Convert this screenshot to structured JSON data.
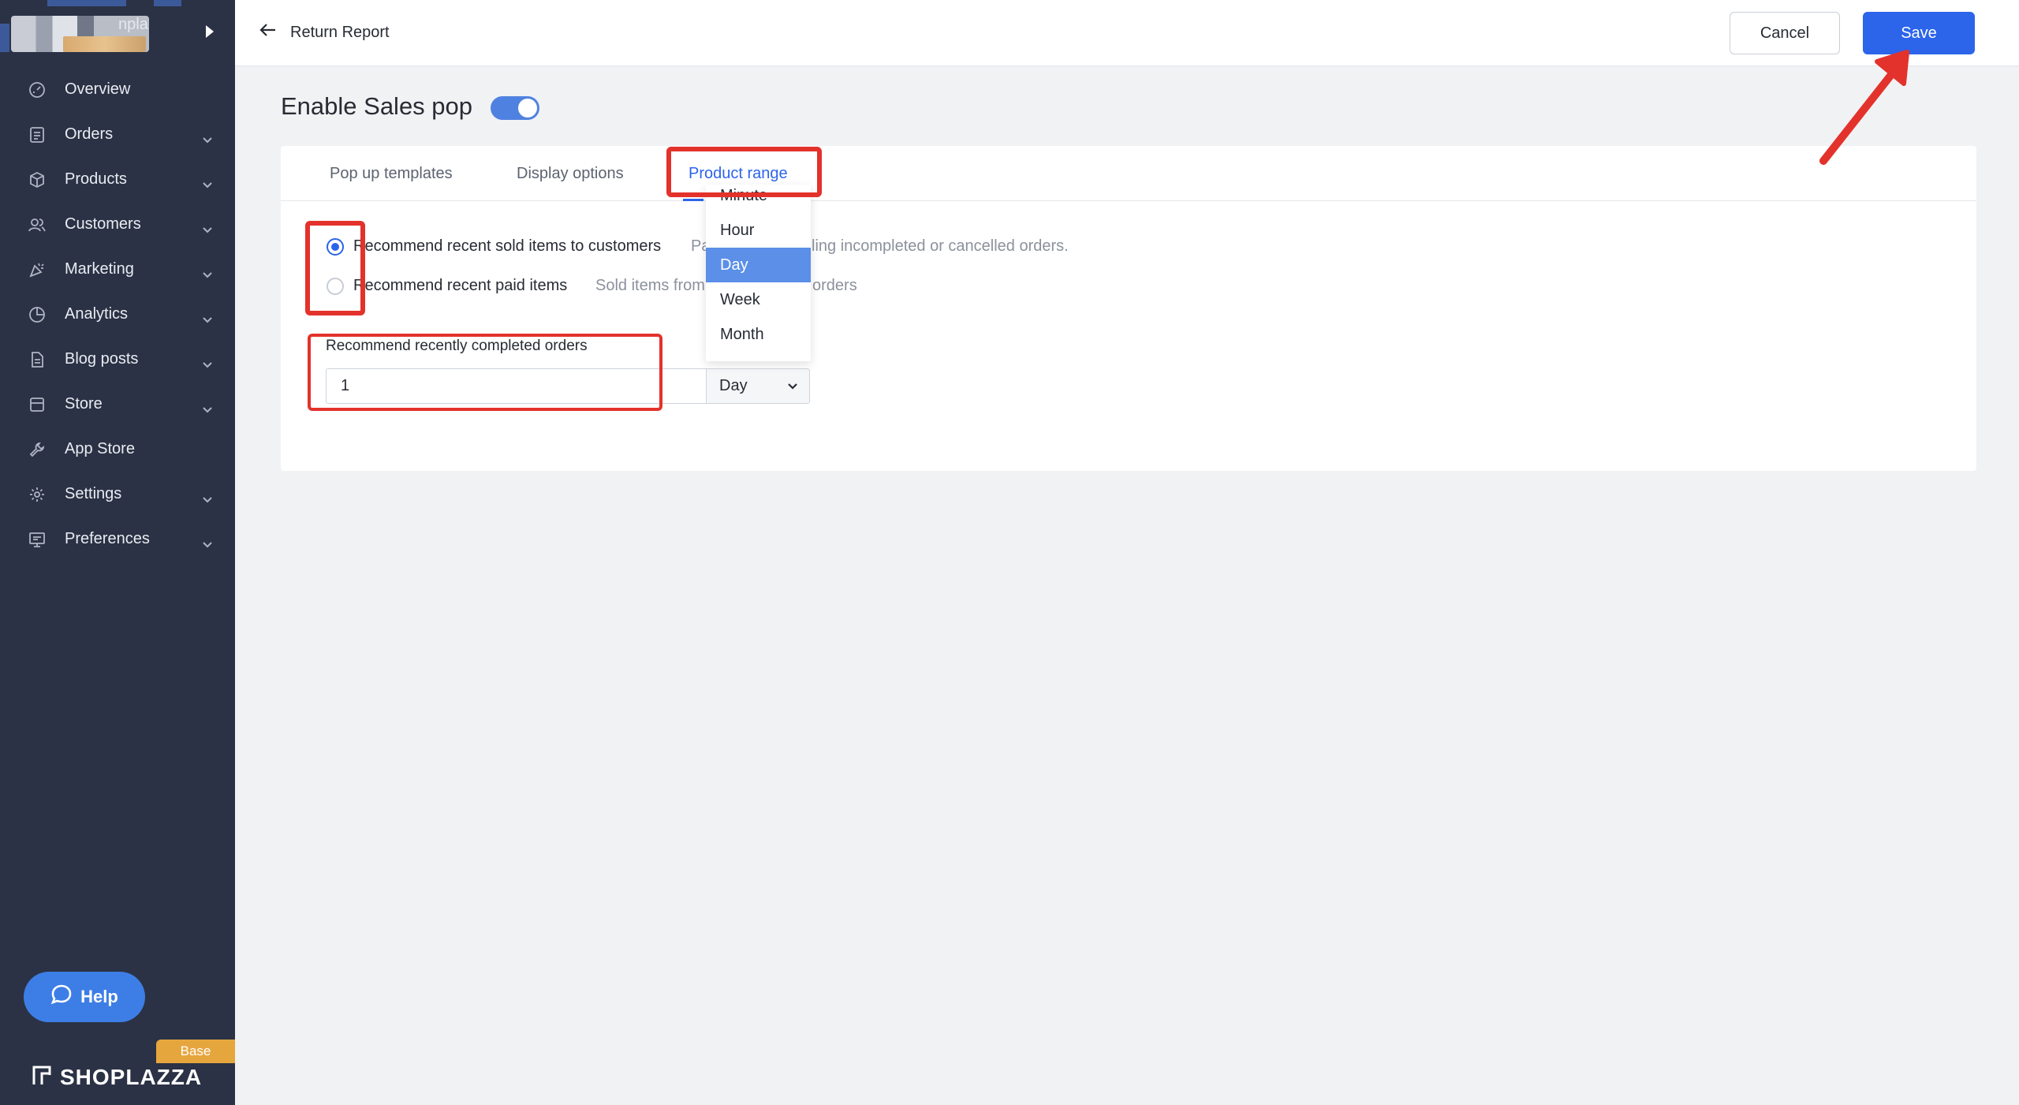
{
  "sidebar": {
    "store_partial_text": "npla",
    "items": [
      {
        "label": "Overview",
        "icon": "gauge-icon",
        "has_chevron": false
      },
      {
        "label": "Orders",
        "icon": "orders-icon",
        "has_chevron": true
      },
      {
        "label": "Products",
        "icon": "box-icon",
        "has_chevron": true
      },
      {
        "label": "Customers",
        "icon": "users-icon",
        "has_chevron": true
      },
      {
        "label": "Marketing",
        "icon": "megaphone-icon",
        "has_chevron": true
      },
      {
        "label": "Analytics",
        "icon": "pie-chart-icon",
        "has_chevron": true
      },
      {
        "label": "Blog posts",
        "icon": "document-icon",
        "has_chevron": true
      },
      {
        "label": "Store",
        "icon": "store-icon",
        "has_chevron": true
      },
      {
        "label": "App Store",
        "icon": "wrench-icon",
        "has_chevron": false
      },
      {
        "label": "Settings",
        "icon": "gear-icon",
        "has_chevron": true
      },
      {
        "label": "Preferences",
        "icon": "monitor-icon",
        "has_chevron": true
      }
    ],
    "help_label": "Help",
    "plan_badge": "Base",
    "brand": "SHOPLAZZA"
  },
  "header": {
    "back_label": "Return Report",
    "cancel_label": "Cancel",
    "save_label": "Save"
  },
  "page": {
    "title": "Enable Sales pop",
    "toggle_on": true
  },
  "tabs": [
    {
      "label": "Pop up templates",
      "active": false
    },
    {
      "label": "Display options",
      "active": false
    },
    {
      "label": "Product range",
      "active": true
    }
  ],
  "options": {
    "option1_label": "Recommend recent sold items to customers",
    "option1_hint_a": "Pa",
    "option1_hint_b": "ling incompleted or cancelled orders.",
    "option2_label": "Recommend recent paid items",
    "option2_hint_a": "Sold items from",
    "option2_hint_b": "orders",
    "selected": 1
  },
  "range": {
    "label": "Recommend recently completed orders",
    "value": "1",
    "unit": "Day",
    "unit_options": [
      "Minute",
      "Hour",
      "Day",
      "Week",
      "Month"
    ],
    "unit_selected": "Day"
  },
  "colors": {
    "sidebar_bg": "#2b3245",
    "accent": "#2c64ea",
    "annotation_red": "#e3322b",
    "help_button": "#3d7ee6",
    "badge": "#e6a63e"
  }
}
